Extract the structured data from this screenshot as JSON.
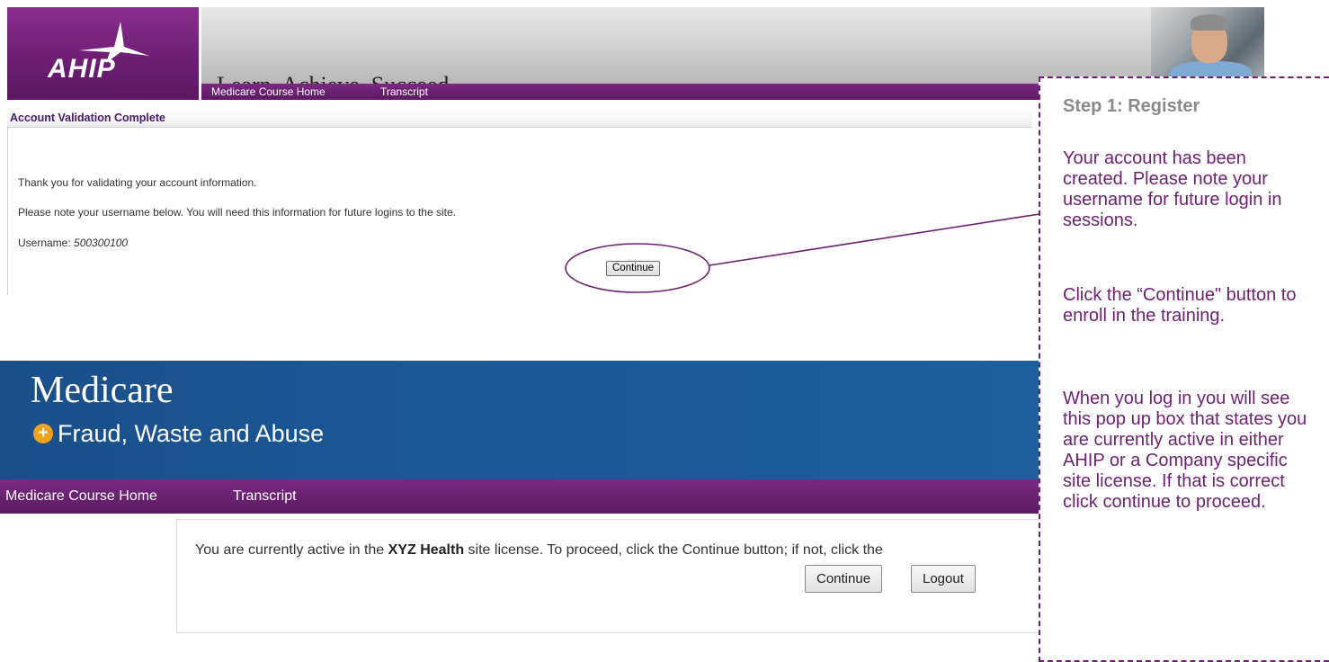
{
  "ahip": {
    "logo_text": "AHIP",
    "tagline": "Learn. Achieve. Succeed.",
    "nav": [
      "Medicare Course Home",
      "Transcript"
    ],
    "section_title": "Account Validation Complete",
    "thank_you": "Thank you for validating your account information.",
    "note": "Please note your username below. You will need this information for future logins to the site.",
    "username_label": "Username: ",
    "username_value": "500300100",
    "continue_label": "Continue"
  },
  "medicare": {
    "title": "Medicare",
    "plus": "+",
    "subtitle": "Fraud, Waste and Abuse",
    "nav": [
      "Medicare Course Home",
      "Transcript"
    ],
    "message_before": "You are currently active in the ",
    "message_bold": "XYZ Health",
    "message_after": " site license. To proceed, click the Continue button; if not, click the",
    "continue_label": "Continue",
    "logout_label": "Logout"
  },
  "callout": {
    "title": "Step 1: Register",
    "paragraph1": "Your account has been created. Please note your username for future login in sessions.",
    "paragraph2": "Click the “Continue\" button to enroll in the training.",
    "paragraph3": "When you log in you will see this pop up box that states you are currently active in either AHIP or a Company specific site license. If that is correct click continue to proceed."
  },
  "colors": {
    "ahip_purple": "#6e1f74",
    "medicare_blue": "#1c5796",
    "plus_orange": "#f0a21c",
    "callout_text": "#6e1f74"
  }
}
